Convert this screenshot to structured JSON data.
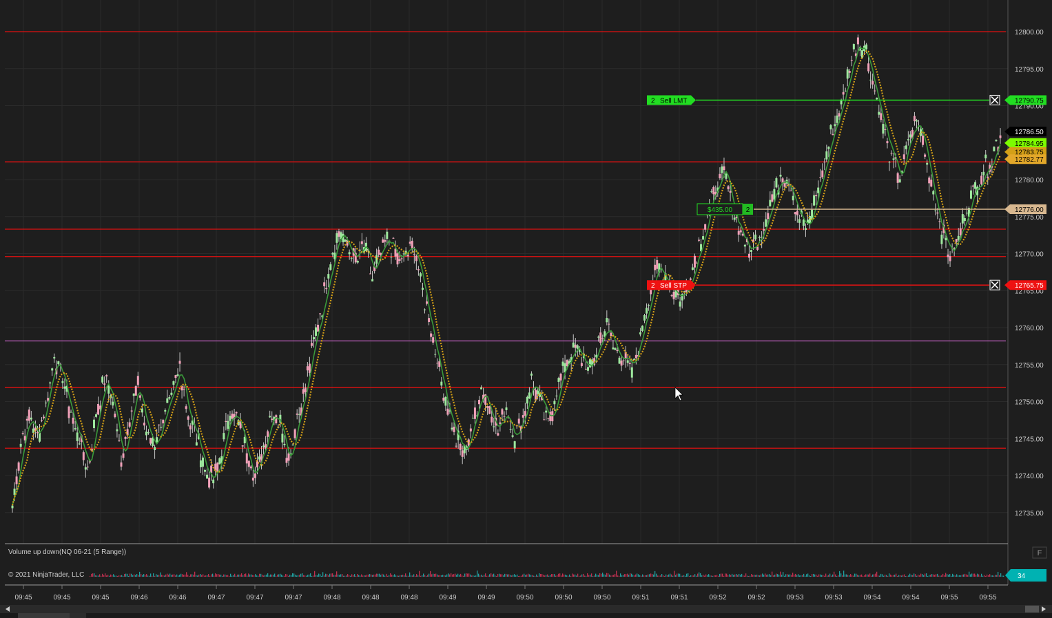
{
  "price_axis": {
    "ticks": [
      {
        "price": 12800,
        "label": "12800.00"
      },
      {
        "price": 12795,
        "label": "12795.00"
      },
      {
        "price": 12790,
        "label": "12790.00"
      },
      {
        "price": 12780,
        "label": "12780.00"
      },
      {
        "price": 12775,
        "label": "12775.00"
      },
      {
        "price": 12770,
        "label": "12770.00"
      },
      {
        "price": 12765,
        "label": "12765.00"
      },
      {
        "price": 12760,
        "label": "12760.00"
      },
      {
        "price": 12755,
        "label": "12755.00"
      },
      {
        "price": 12750,
        "label": "12750.00"
      },
      {
        "price": 12745,
        "label": "12745.00"
      },
      {
        "price": 12740,
        "label": "12740.00"
      },
      {
        "price": 12735,
        "label": "12735.00"
      }
    ],
    "markers": [
      {
        "price": 12790.75,
        "label": "12790.75",
        "bg": "#22dd22",
        "fg": "#000000"
      },
      {
        "price": 12786.5,
        "label": "12786.50",
        "bg": "#000000",
        "fg": "#ffffff"
      },
      {
        "price": 12784.95,
        "label": "12784.95",
        "bg": "#7cfc00",
        "fg": "#000000"
      },
      {
        "price": 12783.75,
        "label": "12783.75",
        "bg": "#d4a017",
        "fg": "#000000"
      },
      {
        "price": 12782.77,
        "label": "12782.77",
        "bg": "#e3a82a",
        "fg": "#000000"
      },
      {
        "price": 12776.0,
        "label": "12776.00",
        "bg": "#d8b890",
        "fg": "#000000"
      },
      {
        "price": 12765.75,
        "label": "12765.75",
        "bg": "#ee1111",
        "fg": "#ffffff"
      }
    ]
  },
  "time_axis": {
    "labels": [
      "09:45",
      "09:45",
      "09:45",
      "09:46",
      "09:46",
      "09:47",
      "09:47",
      "09:47",
      "09:48",
      "09:48",
      "09:48",
      "09:49",
      "09:49",
      "09:50",
      "09:50",
      "09:50",
      "09:51",
      "09:51",
      "09:52",
      "09:52",
      "09:53",
      "09:53",
      "09:54",
      "09:54",
      "09:55",
      "09:55"
    ]
  },
  "horizontal_lines": [
    {
      "price": 12800.0,
      "color": "#e01010"
    },
    {
      "price": 12782.4,
      "color": "#e01010"
    },
    {
      "price": 12773.3,
      "color": "#e01010"
    },
    {
      "price": 12769.6,
      "color": "#e01010"
    },
    {
      "price": 12758.2,
      "color": "#c060c0"
    },
    {
      "price": 12751.9,
      "color": "#e01010"
    },
    {
      "price": 12743.7,
      "color": "#e01010"
    }
  ],
  "orders": {
    "sell_limit": {
      "qty": "2",
      "label": "Sell LMT",
      "price": 12790.75,
      "color": "#22dd22"
    },
    "sell_stop": {
      "qty": "2",
      "label": "Sell STP",
      "price": 12765.75,
      "color": "#ee1111"
    },
    "position": {
      "pnl": "$435.00",
      "qty": "2",
      "price": 12776.0,
      "color": "#d8b890"
    }
  },
  "indicator_panel": {
    "title": "Volume up down(NQ 06-21 (5 Range))",
    "value": "34",
    "value_color": "#00b2b2",
    "f_button": "F"
  },
  "copyright": "© 2021 NinjaTrader, LLC",
  "chart_data": {
    "type": "line",
    "title": "",
    "xlabel": "",
    "ylabel": "",
    "ylim": [
      12733,
      12802
    ],
    "series": [
      {
        "values": [
          12736,
          12744,
          12748,
          12745,
          12750,
          12756,
          12753,
          12748,
          12745,
          12741,
          12748,
          12753,
          12750,
          12742,
          12748,
          12752,
          12746,
          12744,
          12748,
          12750,
          12755,
          12748,
          12745,
          12741,
          12739,
          12743,
          12749,
          12747,
          12743,
          12740,
          12744,
          12749,
          12747,
          12742,
          12748,
          12752,
          12758,
          12763,
          12769,
          12773,
          12771,
          12769,
          12771,
          12767,
          12770,
          12772,
          12769,
          12770,
          12771,
          12765,
          12760,
          12754,
          12749,
          12745,
          12743,
          12747,
          12752,
          12749,
          12746,
          12749,
          12745,
          12748,
          12753,
          12750,
          12747,
          12751,
          12755,
          12757,
          12756,
          12754,
          12758,
          12760,
          12757,
          12756,
          12754,
          12759,
          12764,
          12768,
          12767,
          12765,
          12764,
          12767,
          12771,
          12775,
          12779,
          12781,
          12776,
          12773,
          12770,
          12772,
          12775,
          12778,
          12781,
          12779,
          12775,
          12773,
          12778,
          12782,
          12787,
          12790,
          12795,
          12799,
          12797,
          12792,
          12787,
          12783,
          12780,
          12785,
          12788,
          12784,
          12778,
          12773,
          12770,
          12772,
          12776,
          12779,
          12781,
          12783,
          12786
        ]
      }
    ]
  }
}
